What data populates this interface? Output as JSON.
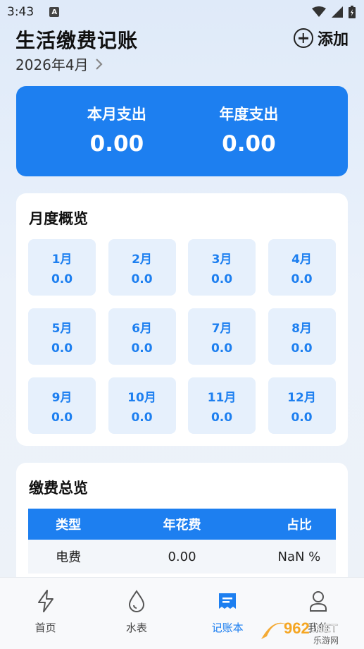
{
  "status_bar": {
    "time": "3:43",
    "notification_badge": "A"
  },
  "header": {
    "title": "生活缴费记账",
    "add_label": "添加",
    "current_month": "2026年4月"
  },
  "summary": {
    "monthly_label": "本月支出",
    "monthly_value": "0.00",
    "yearly_label": "年度支出",
    "yearly_value": "0.00"
  },
  "monthly_overview": {
    "heading": "月度概览",
    "months": [
      {
        "month": "1月",
        "value": "0.0"
      },
      {
        "month": "2月",
        "value": "0.0"
      },
      {
        "month": "3月",
        "value": "0.0"
      },
      {
        "month": "4月",
        "value": "0.0"
      },
      {
        "month": "5月",
        "value": "0.0"
      },
      {
        "month": "6月",
        "value": "0.0"
      },
      {
        "month": "7月",
        "value": "0.0"
      },
      {
        "month": "8月",
        "value": "0.0"
      },
      {
        "month": "9月",
        "value": "0.0"
      },
      {
        "month": "10月",
        "value": "0.0"
      },
      {
        "month": "11月",
        "value": "0.0"
      },
      {
        "month": "12月",
        "value": "0.0"
      }
    ]
  },
  "payment_overview": {
    "heading": "缴费总览",
    "columns": [
      "类型",
      "年花费",
      "占比"
    ],
    "rows": [
      {
        "type": "电费",
        "annual": "0.00",
        "ratio": "NaN %"
      }
    ]
  },
  "bottom_nav": {
    "items": [
      {
        "label": "首页",
        "icon": "lightning-icon"
      },
      {
        "label": "水表",
        "icon": "water-drop-icon"
      },
      {
        "label": "记账本",
        "icon": "ledger-icon"
      },
      {
        "label": "我的",
        "icon": "user-icon"
      }
    ],
    "active_index": 2
  },
  "watermark": {
    "text": "962.NET",
    "subtext": "乐游网"
  },
  "colors": {
    "accent": "#1d7ff0",
    "tile_bg": "#e6f0fc",
    "page_bg": "#e6eef9"
  }
}
